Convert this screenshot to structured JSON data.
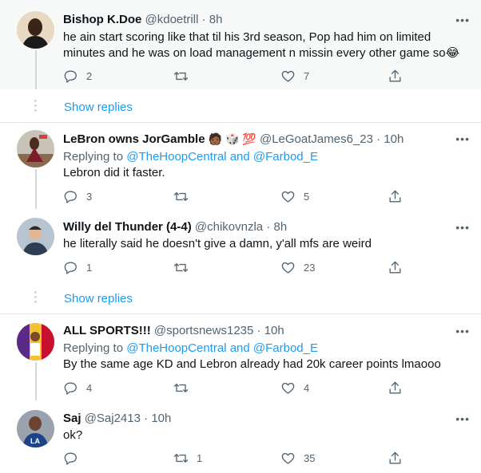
{
  "tweets": [
    {
      "name": "Bishop K.Doe",
      "handle": "@kdoetrill",
      "time": "8h",
      "text": "he ain start scoring like that til his 3rd season, Pop had him on limited minutes and he was on load management n missin every other game so😂",
      "reply_count": "2",
      "retweet_count": "",
      "like_count": "7"
    },
    {
      "name": "LeBron owns JorGamble",
      "name_emoji": "🧑🏾 🎲 💯",
      "handle": "@LeGoatJames6_23",
      "time": "10h",
      "replying_prefix": "Replying to",
      "replying_user1": "@TheHoopCentral",
      "replying_and": "and",
      "replying_user2": "@Farbod_E",
      "text": "Lebron did it faster.",
      "reply_count": "3",
      "retweet_count": "",
      "like_count": "5"
    },
    {
      "name": "Willy del Thunder (4-4)",
      "handle": "@chikovnzla",
      "time": "8h",
      "text": "he literally said he doesn't give a damn, y'all mfs are weird",
      "reply_count": "1",
      "retweet_count": "",
      "like_count": "23"
    },
    {
      "name": "ALL SPORTS!!!",
      "handle": "@sportsnews1235",
      "time": "10h",
      "replying_prefix": "Replying to",
      "replying_user1": "@TheHoopCentral",
      "replying_and": "and",
      "replying_user2": "@Farbod_E",
      "text": "By the same age KD and Lebron already had 20k career points lmaooo",
      "reply_count": "4",
      "retweet_count": "",
      "like_count": "4"
    },
    {
      "name": "Saj",
      "handle": "@Saj2413",
      "time": "10h",
      "text": "ok?",
      "reply_count": "",
      "retweet_count": "1",
      "like_count": "35"
    }
  ],
  "show_replies_label": "Show replies",
  "separator_dot": "·",
  "more_icon": "•••",
  "icons": {
    "reply": "reply-icon",
    "retweet": "retweet-icon",
    "like": "heart-icon",
    "share": "share-icon",
    "more": "more-icon"
  },
  "colors": {
    "accent": "#1d9bf0",
    "muted": "#536471",
    "highlight_bg": "#f7f9f9",
    "divider": "#e1e8ed"
  }
}
